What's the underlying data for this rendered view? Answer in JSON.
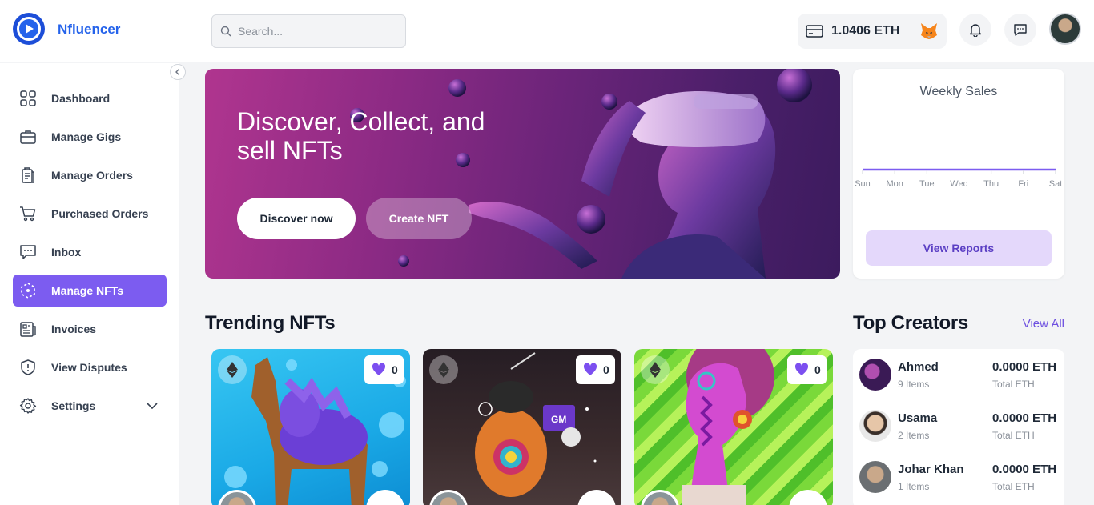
{
  "app": {
    "name": "Nfluencer"
  },
  "search": {
    "placeholder": "Search..."
  },
  "wallet": {
    "balance": "1.0406 ETH"
  },
  "sidebar": {
    "items": [
      {
        "label": "Dashboard",
        "icon": "grid-icon"
      },
      {
        "label": "Manage Gigs",
        "icon": "briefcase-icon"
      },
      {
        "label": "Manage Orders",
        "icon": "clipboard-icon"
      },
      {
        "label": "Purchased Orders",
        "icon": "cart-icon"
      },
      {
        "label": "Inbox",
        "icon": "chat-icon"
      },
      {
        "label": "Manage NFTs",
        "icon": "nft-icon",
        "active": true
      },
      {
        "label": "Invoices",
        "icon": "invoice-icon"
      },
      {
        "label": "View Disputes",
        "icon": "shield-icon"
      },
      {
        "label": "Settings",
        "icon": "gear-icon"
      }
    ]
  },
  "hero": {
    "title": "Discover, Collect, and sell NFTs",
    "discover_label": "Discover now",
    "create_label": "Create NFT"
  },
  "weekly_sales": {
    "title": "Weekly Sales",
    "button_label": "View Reports",
    "chart_data": {
      "type": "line",
      "categories": [
        "Sun",
        "Mon",
        "Tue",
        "Wed",
        "Thu",
        "Fri",
        "Sat"
      ],
      "values": [
        0,
        0,
        0,
        0,
        0,
        0,
        0
      ],
      "title": "Weekly Sales",
      "grid": false
    }
  },
  "trending": {
    "title": "Trending NFTs",
    "cards": [
      {
        "likes": "0"
      },
      {
        "likes": "0"
      },
      {
        "likes": "0"
      }
    ]
  },
  "creators": {
    "title": "Top Creators",
    "view_all": "View All",
    "list": [
      {
        "name": "Ahmed",
        "items": "9 Items",
        "eth": "0.0000 ETH",
        "total_label": "Total ETH"
      },
      {
        "name": "Usama",
        "items": "2 Items",
        "eth": "0.0000 ETH",
        "total_label": "Total ETH"
      },
      {
        "name": "Johar Khan",
        "items": "1 Items",
        "eth": "0.0000 ETH",
        "total_label": "Total ETH"
      }
    ]
  },
  "colors": {
    "accent": "#7c5cf0",
    "brand": "#2563eb"
  }
}
